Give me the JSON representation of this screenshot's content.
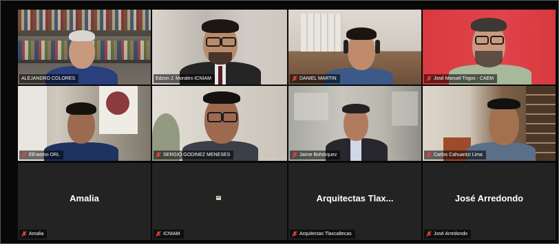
{
  "participants": [
    {
      "name": "ALEJANDRO COLORES",
      "muted": true
    },
    {
      "name": "Edzon J. Morales-ICNIAM",
      "muted": true,
      "active_speaker": true
    },
    {
      "name": "DANIEL MARTIN",
      "muted": true
    },
    {
      "name": "José Manuel Trigos - CAEM",
      "muted": true
    },
    {
      "name": "EErasmo DRL",
      "muted": true
    },
    {
      "name": "SERGIO GODINEZ MENESES",
      "muted": true
    },
    {
      "name": "Jaime Bohórquez",
      "muted": true
    },
    {
      "name": "Carlos Cahuantzi Lima",
      "muted": true
    },
    {
      "name": "Amalia",
      "display": "Amalia",
      "muted": true,
      "video_off": true
    },
    {
      "name": "ICNIAM",
      "display": "",
      "muted": true,
      "video_off": true,
      "has_logo": true
    },
    {
      "name": "Arquitectas Tlaxcaltecas",
      "display": "Arquitectas Tlax...",
      "muted": true,
      "video_off": true
    },
    {
      "name": "José Arredondo",
      "display": "José Arredondo",
      "muted": true,
      "video_off": true
    }
  ],
  "colors": {
    "active_speaker_border": "#cfe27a",
    "muted_icon": "#e0463f",
    "empty_tile": "#232323"
  },
  "icons": {
    "muted": "muted-microphone-icon"
  }
}
